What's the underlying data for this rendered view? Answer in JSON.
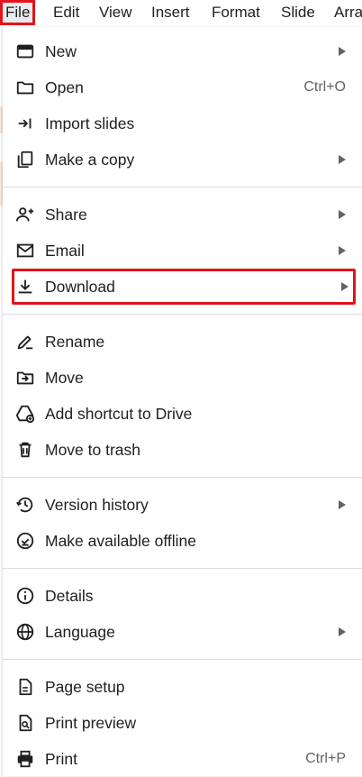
{
  "menubar": {
    "items": [
      {
        "label": "File"
      },
      {
        "label": "Edit"
      },
      {
        "label": "View"
      },
      {
        "label": "Insert"
      },
      {
        "label": "Format"
      },
      {
        "label": "Slide"
      },
      {
        "label": "Arra"
      }
    ],
    "active": "File"
  },
  "file_menu": {
    "new": {
      "label": "New",
      "icon": "slides-new-icon",
      "submenu": true
    },
    "open": {
      "label": "Open",
      "icon": "folder-icon",
      "shortcut": "Ctrl+O"
    },
    "import_slides": {
      "label": "Import slides",
      "icon": "import-icon"
    },
    "make_copy": {
      "label": "Make a copy",
      "icon": "copy-icon",
      "submenu": true
    },
    "share": {
      "label": "Share",
      "icon": "person-add-icon",
      "submenu": true
    },
    "email": {
      "label": "Email",
      "icon": "mail-icon",
      "submenu": true
    },
    "download": {
      "label": "Download",
      "icon": "download-icon",
      "submenu": true,
      "highlighted": true
    },
    "rename": {
      "label": "Rename",
      "icon": "rename-icon"
    },
    "move": {
      "label": "Move",
      "icon": "move-folder-icon"
    },
    "add_shortcut": {
      "label": "Add shortcut to Drive",
      "icon": "drive-shortcut-icon"
    },
    "trash": {
      "label": "Move to trash",
      "icon": "trash-icon"
    },
    "version_history": {
      "label": "Version history",
      "icon": "history-icon",
      "submenu": true
    },
    "offline": {
      "label": "Make available offline",
      "icon": "offline-check-icon"
    },
    "details": {
      "label": "Details",
      "icon": "info-icon"
    },
    "language": {
      "label": "Language",
      "icon": "globe-icon",
      "submenu": true
    },
    "page_setup": {
      "label": "Page setup",
      "icon": "page-icon"
    },
    "print_preview": {
      "label": "Print preview",
      "icon": "print-preview-icon"
    },
    "print": {
      "label": "Print",
      "icon": "printer-icon",
      "shortcut": "Ctrl+P"
    }
  },
  "colors": {
    "highlight_border": "#e2141a",
    "text": "#1f1f1f",
    "muted": "#5f6368",
    "divider": "#dadce0"
  }
}
